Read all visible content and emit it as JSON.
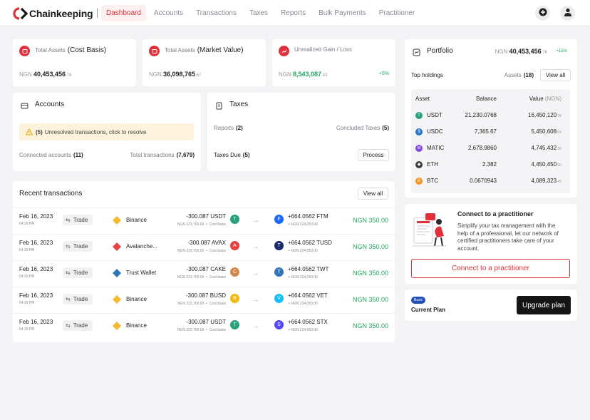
{
  "brand": {
    "name": "Chainkeeping",
    "accent": "#e0303b"
  },
  "nav": {
    "items": [
      {
        "label": "Dashboard",
        "active": true
      },
      {
        "label": "Accounts"
      },
      {
        "label": "Transactions"
      },
      {
        "label": "Taxes"
      },
      {
        "label": "Reports"
      },
      {
        "label": "Bulk Payments"
      },
      {
        "label": "Practitioner"
      }
    ]
  },
  "header": {
    "add_icon": "plus-circle-icon",
    "user_icon": "user-icon"
  },
  "stats": [
    {
      "label": "Total Assets",
      "label_strong": "(Cost Basis)",
      "currency": "NGN",
      "value": "40,453,456",
      "decimals": ".76",
      "icon": "wallet-icon"
    },
    {
      "label": "Total Assets",
      "label_strong": "(Market Value)",
      "currency": "NGN",
      "value": "36,098,765",
      "decimals": ".67",
      "icon": "wallet-icon"
    },
    {
      "label": "Unrealized Gain / Loss",
      "label_strong": "",
      "currency": "NGN",
      "value": "8,543,087",
      "decimals": ".43",
      "badge": "+5%",
      "icon": "chart-icon"
    }
  ],
  "accounts": {
    "title": "Accounts",
    "alert_count": "(5)",
    "alert_text": "Unresolved transactions, click to resolve",
    "connected_label": "Connected accounts",
    "connected_count": "(11)",
    "total_label": "Total transactions",
    "total_count": "(7,679)"
  },
  "taxes": {
    "title": "Taxes",
    "reports_label": "Reports",
    "reports_count": "(2)",
    "concluded_label": "Concluded Taxes",
    "concluded_count": "(5)",
    "due_label": "Taxes Due",
    "due_count": "(5)",
    "process_label": "Process"
  },
  "recent": {
    "title": "Recent transactions",
    "view_all": "View all",
    "rows": [
      {
        "date": "Feb 16, 2023",
        "time": "04:29 PM",
        "type": "Trade",
        "wallet": "Binance",
        "wallet_color": "#f3ba2f",
        "out": "-300.087 USDT",
        "out_sub": "NGN 223,700.00",
        "out_cost": "Cost basis",
        "out_coin_color": "#26a17b",
        "out_glyph": "T",
        "in": "+664.0562 FTM",
        "in_sub": "+ NGN 224,050.00",
        "in_coin_color": "#1969ff",
        "in_glyph": "F",
        "amount": "NGN 350.00"
      },
      {
        "date": "Feb 16, 2023",
        "time": "04:29 PM",
        "type": "Trade",
        "wallet": "Avalanche...",
        "wallet_color": "#e84142",
        "out": "-300.087 AVAX",
        "out_sub": "NGN 223,700.00",
        "out_cost": "Cost basis",
        "out_coin_color": "#e84142",
        "out_glyph": "A",
        "in": "+664.0562 TUSD",
        "in_sub": "+ NGN 224,050.00",
        "in_coin_color": "#1a2b6b",
        "in_glyph": "T",
        "amount": "NGN 350.00"
      },
      {
        "date": "Feb 16, 2023",
        "time": "04:29 PM",
        "type": "Trade",
        "wallet": "Trust Wallet",
        "wallet_color": "#3375bb",
        "out": "-300.087 CAKE",
        "out_sub": "NGN 223,700.00",
        "out_cost": "Cost basis",
        "out_coin_color": "#d1884f",
        "out_glyph": "C",
        "in": "+664.0562 TWT",
        "in_sub": "+ NGN 224,050.00",
        "in_coin_color": "#3375bb",
        "in_glyph": "T",
        "amount": "NGN 350.00"
      },
      {
        "date": "Feb 16, 2023",
        "time": "04:29 PM",
        "type": "Trade",
        "wallet": "Binance",
        "wallet_color": "#f3ba2f",
        "out": "-300.087 BUSD",
        "out_sub": "NGN 223,700.00",
        "out_cost": "Cost basis",
        "out_coin_color": "#f0b90b",
        "out_glyph": "B",
        "in": "+664.0562 VET",
        "in_sub": "+ NGN 224,050.00",
        "in_coin_color": "#15bdff",
        "in_glyph": "V",
        "amount": "NGN 350.00"
      },
      {
        "date": "Feb 16, 2023",
        "time": "04:29 PM",
        "type": "Trade",
        "wallet": "Binance",
        "wallet_color": "#f3ba2f",
        "out": "-300.087 USDT",
        "out_sub": "NGN 223,700.00",
        "out_cost": "Cost basis",
        "out_coin_color": "#26a17b",
        "out_glyph": "T",
        "in": "+664.0562 STX",
        "in_sub": "+ NGN 224,050.00",
        "in_coin_color": "#5546ff",
        "in_glyph": "S",
        "amount": "NGN 350.00"
      }
    ]
  },
  "portfolio": {
    "title": "Portfolio",
    "currency": "NGN",
    "value": "40,453,456",
    "decimals": ".76",
    "change": "+15%",
    "top_holdings": "Top holdings",
    "assets_label": "Assets",
    "assets_count": "(18)",
    "view_all": "View all",
    "columns": {
      "asset": "Asset",
      "balance": "Balance",
      "value": "Value",
      "value_unit": "(NGN)"
    },
    "holdings": [
      {
        "symbol": "USDT",
        "balance": "21,230.0768",
        "value": "16,450,120",
        "decimals": ".78",
        "color": "#26a17b",
        "glyph": "T"
      },
      {
        "symbol": "USDC",
        "balance": "7,365.67",
        "value": "5,450,608",
        "decimals": ".04",
        "color": "#2775ca",
        "glyph": "$"
      },
      {
        "symbol": "MATIC",
        "balance": "2,678.9860",
        "value": "4,745,432",
        "decimals": ".56",
        "color": "#8247e5",
        "glyph": "M"
      },
      {
        "symbol": "ETH",
        "balance": "2.382",
        "value": "4,450,450",
        "decimals": ".00",
        "color": "#3c3c3d",
        "glyph": "◆"
      },
      {
        "symbol": "BTC",
        "balance": "0.0670943",
        "value": "4,089,323",
        "decimals": ".45",
        "color": "#f7931a",
        "glyph": "B"
      }
    ]
  },
  "practitioner": {
    "title": "Connect to a practitioner",
    "body": "Simplify your tax management with the help of a professional, let our network of certified practitioners take care of your account.",
    "button": "Connect to a practitioner"
  },
  "plan": {
    "badge": "Basic",
    "label": "Current Plan",
    "button": "Upgrade plan"
  }
}
